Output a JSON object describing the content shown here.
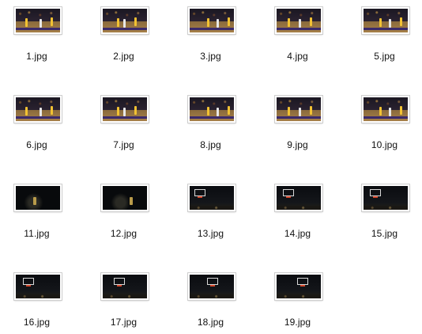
{
  "files": [
    {
      "name": "1.jpg",
      "scene": "court"
    },
    {
      "name": "2.jpg",
      "scene": "court"
    },
    {
      "name": "3.jpg",
      "scene": "court"
    },
    {
      "name": "4.jpg",
      "scene": "court"
    },
    {
      "name": "5.jpg",
      "scene": "court"
    },
    {
      "name": "6.jpg",
      "scene": "court"
    },
    {
      "name": "7.jpg",
      "scene": "court"
    },
    {
      "name": "8.jpg",
      "scene": "court"
    },
    {
      "name": "9.jpg",
      "scene": "court"
    },
    {
      "name": "10.jpg",
      "scene": "court"
    },
    {
      "name": "11.jpg",
      "scene": "dark"
    },
    {
      "name": "12.jpg",
      "scene": "dark"
    },
    {
      "name": "13.jpg",
      "scene": "hoop"
    },
    {
      "name": "14.jpg",
      "scene": "hoop"
    },
    {
      "name": "15.jpg",
      "scene": "hoop"
    },
    {
      "name": "16.jpg",
      "scene": "hoop"
    },
    {
      "name": "17.jpg",
      "scene": "hoop"
    },
    {
      "name": "18.jpg",
      "scene": "hoop"
    },
    {
      "name": "19.jpg",
      "scene": "hoop"
    }
  ]
}
